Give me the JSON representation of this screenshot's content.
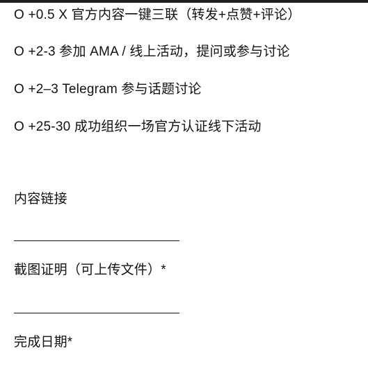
{
  "reward_options": [
    "O +0.5 X 官方内容一键三联（转发+点赞+评论）",
    "O +2-3 参加 AMA / 线上活动，提问或参与讨论",
    "O +2–3 Telegram 参与话题讨论",
    "O +25-30 成功组织一场官方认证线下活动"
  ],
  "form_fields": [
    {
      "label": "内容链接"
    },
    {
      "label": "截图证明（可上传文件）*"
    },
    {
      "label": "完成日期*"
    }
  ]
}
